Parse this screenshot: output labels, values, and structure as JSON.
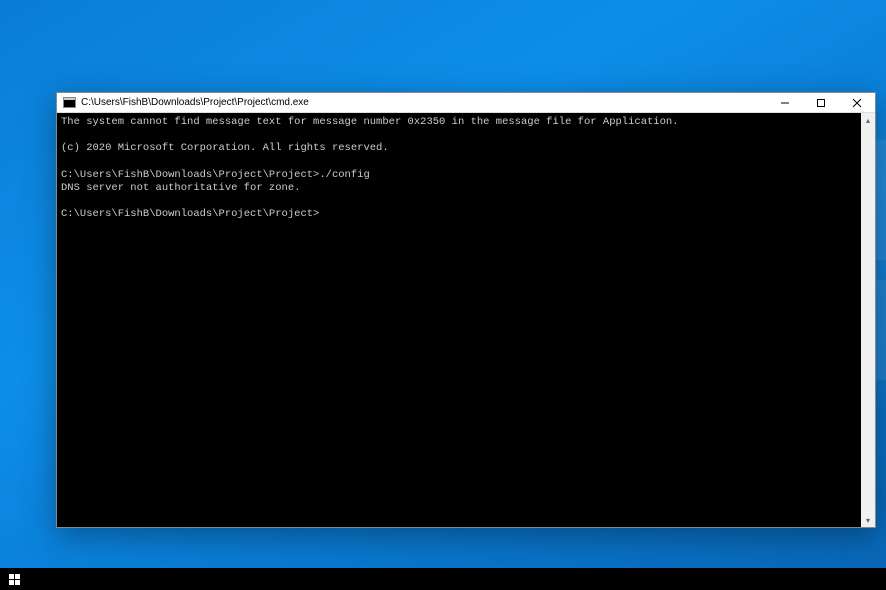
{
  "window": {
    "title": "C:\\Users\\FishB\\Downloads\\Project\\Project\\cmd.exe",
    "icon_name": "cmd-icon"
  },
  "terminal": {
    "lines": [
      "The system cannot find message text for message number 0x2350 in the message file for Application.",
      "",
      "(c) 2020 Microsoft Corporation. All rights reserved.",
      "",
      "C:\\Users\\FishB\\Downloads\\Project\\Project>./config",
      "DNS server not authoritative for zone.",
      "",
      "C:\\Users\\FishB\\Downloads\\Project\\Project>"
    ]
  },
  "controls": {
    "minimize_title": "Minimize",
    "maximize_title": "Maximize",
    "close_title": "Close"
  },
  "taskbar": {
    "start_title": "Start"
  }
}
